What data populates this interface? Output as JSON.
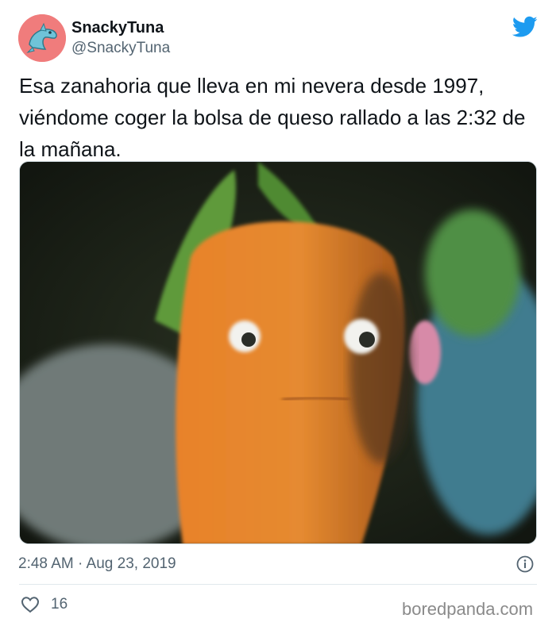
{
  "tweet": {
    "author": {
      "display_name": "SnackyTuna",
      "handle": "@SnackyTuna",
      "avatar": "dolphin-avatar"
    },
    "text": "Esa zanahoria que lleva en mi nevera desde 1997, viéndome coger la bolsa de queso rallado a las 2:32 de la mañana.",
    "media": {
      "description_icon": "carrot-with-googly-eyes-photo"
    },
    "timestamp": "2:48 AM · Aug 23, 2019",
    "likes": "16"
  },
  "icons": {
    "platform": "twitter-bird-icon",
    "info": "info-icon",
    "like": "heart-icon"
  },
  "watermark": "boredpanda.com",
  "colors": {
    "twitter_blue": "#1d9bf0",
    "secondary_text": "#536471",
    "avatar_bg": "#f07c7c"
  }
}
